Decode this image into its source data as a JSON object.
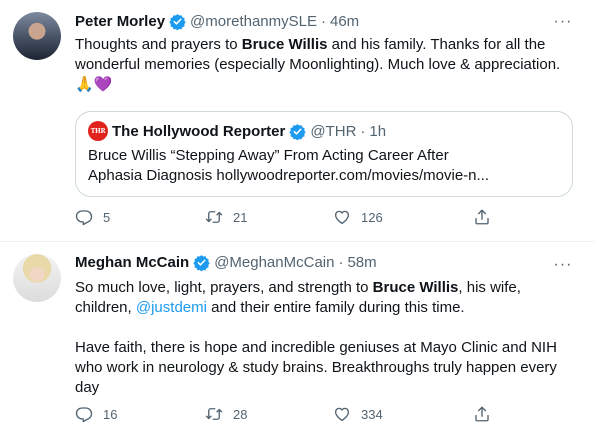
{
  "tweets": [
    {
      "name": "Peter Morley",
      "handle": "@morethanmySLE",
      "separator": "·",
      "time": "46m",
      "text": {
        "p1": "Thoughts and prayers to ",
        "b1": "Bruce Willis",
        "p2": " and his family. Thanks for all the wonderful memories (especially Moonlighting). Much love & appreciation.",
        "emoji": "🙏💜"
      },
      "quote": {
        "avatar_text": "THR",
        "name": "The Hollywood Reporter",
        "handle": "@THR",
        "separator": "·",
        "time": "1h",
        "line1": "Bruce Willis “Stepping Away” From Acting Career After",
        "line2": "Aphasia Diagnosis hollywoodreporter.com/movies/movie-n..."
      },
      "replies": "5",
      "retweets": "21",
      "likes": "126"
    },
    {
      "name": "Meghan McCain",
      "handle": "@MeghanMcCain",
      "separator": "·",
      "time": "58m",
      "text": {
        "p1": "So much love, light, prayers, and strength to ",
        "b1": "Bruce Willis",
        "p2": ", his wife, children, ",
        "mention": "@justdemi",
        "p3": " and their entire family during this time.",
        "p4": "Have faith, there is hope and incredible geniuses at Mayo Clinic and NIH who work in neurology & study brains. Breakthroughs truly happen every day"
      },
      "replies": "16",
      "retweets": "28",
      "likes": "334"
    }
  ],
  "more_icon": "···",
  "colors": {
    "text": "#0f1419",
    "secondary": "#536471",
    "link": "#1d9bf0",
    "verified": "#1d9bf0",
    "border": "#cfd9de",
    "thr_red": "#e0241c"
  }
}
